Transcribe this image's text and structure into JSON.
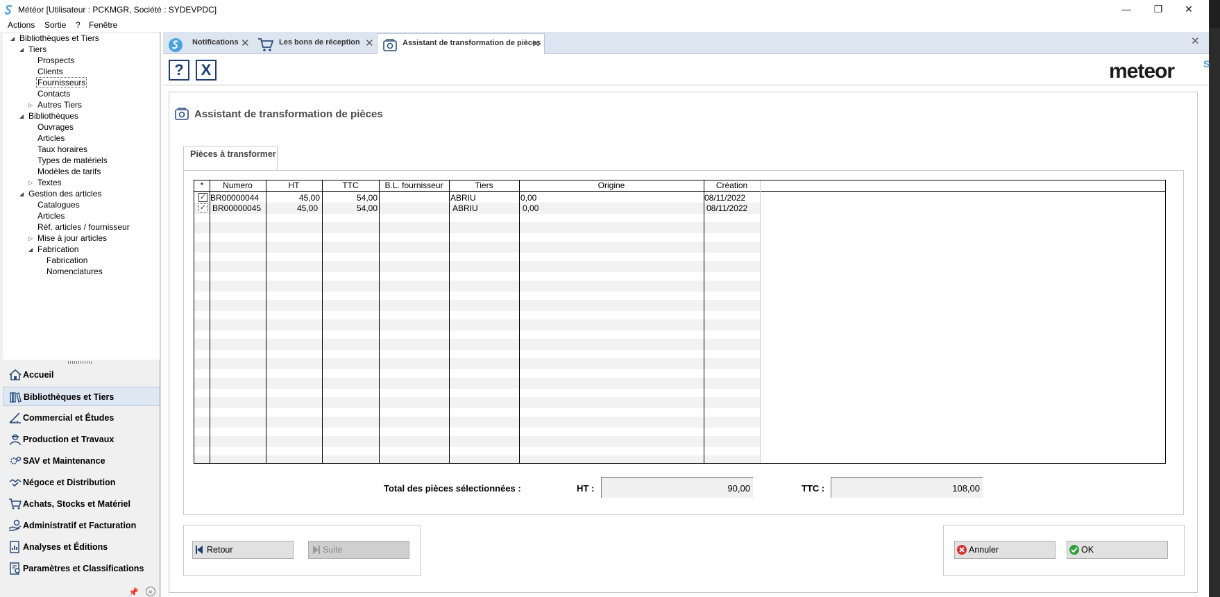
{
  "window": {
    "title": "Météor [Utilisateur : PCKMGR, Société : SYDEVPDC]",
    "controls": {
      "minimize": "—",
      "maximize": "❐",
      "close": "✕"
    }
  },
  "menubar": [
    "Actions",
    "Sortie",
    "?",
    "Fenêtre"
  ],
  "tree": [
    {
      "label": "Bibliothèques et Tiers",
      "expander": "◢"
    },
    {
      "label": "Tiers",
      "expander": "◢"
    },
    {
      "label": "Prospects"
    },
    {
      "label": "Clients"
    },
    {
      "label": "Fournisseurs",
      "selected": true
    },
    {
      "label": "Contacts"
    },
    {
      "label": "Autres Tiers",
      "expander": "▷"
    },
    {
      "label": "Bibliothèques",
      "expander": "◢"
    },
    {
      "label": "Ouvrages"
    },
    {
      "label": "Articles"
    },
    {
      "label": "Taux horaires"
    },
    {
      "label": "Types de matériels"
    },
    {
      "label": "Modèles de tarifs"
    },
    {
      "label": "Textes",
      "expander": "▷"
    },
    {
      "label": "Gestion des articles",
      "expander": "◢"
    },
    {
      "label": "Catalogues"
    },
    {
      "label": "Articles"
    },
    {
      "label": "Réf. articles / fournisseur"
    },
    {
      "label": "Mise à jour articles",
      "expander": "▷"
    },
    {
      "label": "Fabrication",
      "expander": "◢"
    },
    {
      "label": "Fabrication"
    },
    {
      "label": "Nomenclatures"
    }
  ],
  "nav": [
    {
      "label": "Accueil",
      "icon": "home-icon"
    },
    {
      "label": "Bibliothèques et Tiers",
      "icon": "books-icon",
      "active": true
    },
    {
      "label": "Commercial et Études",
      "icon": "ruler-icon"
    },
    {
      "label": "Production et Travaux",
      "icon": "worker-icon"
    },
    {
      "label": "SAV et Maintenance",
      "icon": "gears-icon"
    },
    {
      "label": "Négoce et Distribution",
      "icon": "handshake-icon"
    },
    {
      "label": "Achats, Stocks et Matériel",
      "icon": "cart-icon"
    },
    {
      "label": "Administratif et Facturation",
      "icon": "hand-coin-icon"
    },
    {
      "label": "Analyses et Éditions",
      "icon": "report-icon"
    },
    {
      "label": "Paramètres et Classifications",
      "icon": "settings-icon"
    }
  ],
  "tabs": [
    {
      "label": "Notifications",
      "icon": "notification-icon"
    },
    {
      "label": "Les bons de réception",
      "icon": "cart-icon"
    },
    {
      "label": "Assistant de transformation de pièces",
      "icon": "wizard-icon",
      "active": true
    }
  ],
  "toolbar": {
    "help_label": "?",
    "close_label": "X"
  },
  "logo": {
    "text": "meteor",
    "mark": "S"
  },
  "wizard": {
    "title": "Assistant de transformation de pièces",
    "section_tab": "Pièces à transformer",
    "columns": [
      "*",
      "Numero",
      "HT",
      "TTC",
      "B.L. fournisseur",
      "Tiers",
      "Origine",
      "Création"
    ],
    "rows": [
      {
        "checked": true,
        "numero": "BR00000044",
        "ht": "45,00",
        "ttc": "54,00",
        "bl": "",
        "tiers": "ABRIU",
        "origine": "0,00",
        "creation": "08/11/2022"
      },
      {
        "checked": true,
        "numero": "BR00000045",
        "ht": "45,00",
        "ttc": "54,00",
        "bl": "",
        "tiers": "ABRIU",
        "origine": "0,00",
        "creation": "08/11/2022"
      }
    ],
    "totals": {
      "label": "Total des pièces sélectionnées :",
      "ht_label": "HT :",
      "ht_value": "90,00",
      "ttc_label": "TTC :",
      "ttc_value": "108,00"
    },
    "buttons": {
      "retour": "Retour",
      "suite": "Suite",
      "annuler": "Annuler",
      "ok": "OK"
    }
  },
  "colors": {
    "accent": "#1f3f6e",
    "tab_strip": "#dde6f0",
    "logo_mark": "#4aa3df",
    "ok_green": "#2e9d3a",
    "cancel_red": "#d32f2f"
  }
}
